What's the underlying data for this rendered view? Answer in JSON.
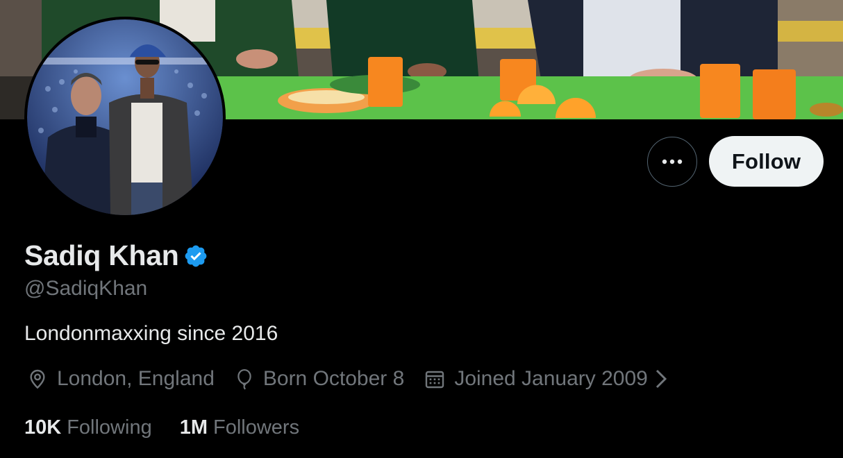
{
  "profile": {
    "name": "Sadiq Khan",
    "handle": "@SadiqKhan",
    "bio": "Londonmaxxing since 2016",
    "verified_color": "#1d9bf0"
  },
  "actions": {
    "more_icon": "ellipsis-icon",
    "follow_label": "Follow"
  },
  "meta": {
    "location": "London, England",
    "birthday": "Born October 8",
    "joined": "Joined January 2009"
  },
  "stats": {
    "following_count": "10K",
    "following_label": "Following",
    "followers_count": "1M",
    "followers_label": "Followers"
  },
  "colors": {
    "background": "#000000",
    "primary_text": "#e7e9ea",
    "secondary_text": "#71767b",
    "follow_bg": "#eff3f4"
  }
}
